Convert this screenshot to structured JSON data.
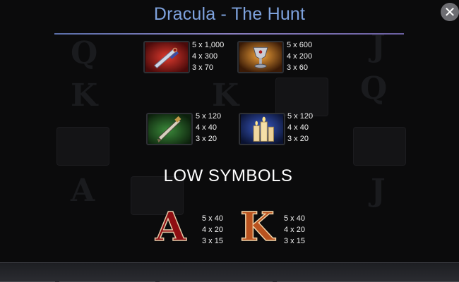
{
  "header": {
    "title": "Dracula - The Hunt",
    "close_label": "✕"
  },
  "high_symbols": [
    {
      "icon": "dagger-icon",
      "pays": [
        "5 x 1,000",
        "4 x 300",
        "3 x 70"
      ]
    },
    {
      "icon": "chalice-icon",
      "pays": [
        "5 x 600",
        "4 x 200",
        "3 x 60"
      ]
    },
    {
      "icon": "stake-icon",
      "pays": [
        "5 x 120",
        "4 x 40",
        "3 x 20"
      ]
    },
    {
      "icon": "candles-icon",
      "pays": [
        "5 x 120",
        "4 x 40",
        "3 x 20"
      ]
    }
  ],
  "low_symbols": {
    "heading": "LOW SYMBOLS",
    "items": [
      {
        "letter": "A",
        "pays": [
          "5 x 40",
          "4 x 20",
          "3 x 15"
        ]
      },
      {
        "letter": "K",
        "pays": [
          "5 x 40",
          "4 x 20",
          "3 x 15"
        ]
      }
    ]
  },
  "colors": {
    "title": "#7ea2dd",
    "letter_a": "#8e0d12",
    "letter_k": "#b9531f"
  }
}
